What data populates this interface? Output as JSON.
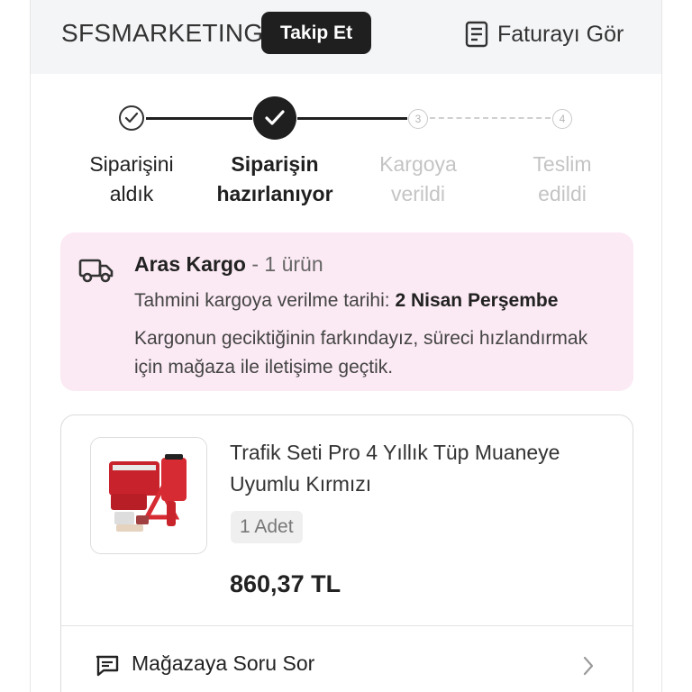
{
  "header": {
    "store_name": "SFSMARKETING",
    "follow_label": "Takip Et",
    "invoice_label": "Faturayı Gör"
  },
  "stepper": {
    "steps": [
      {
        "line1": "Siparişini",
        "line2": "aldık",
        "state": "done"
      },
      {
        "line1": "Siparişin",
        "line2": "hazırlanıyor",
        "state": "current"
      },
      {
        "line1": "Kargoya",
        "line2": "verildi",
        "state": "pending",
        "number": "3"
      },
      {
        "line1": "Teslim",
        "line2": "edildi",
        "state": "pending",
        "number": "4"
      }
    ]
  },
  "cargo": {
    "company": "Aras Kargo",
    "count_text": " - 1 ürün",
    "date_label": "Tahmini kargoya verilme tarihi: ",
    "date_value": "2 Nisan Perşembe",
    "note": "Kargonun geciktiğinin farkındayız, süreci hızlandırmak için mağaza ile iletişime geçtik."
  },
  "product": {
    "name": "Trafik Seti Pro 4 Yıllık Tüp Muaneye Uyumlu Kırmızı",
    "quantity": "1 Adet",
    "price": "860,37 TL"
  },
  "actions": {
    "ask_store_label": "Mağazaya Soru Sor"
  },
  "colors": {
    "accent_dark": "#1f1f1f",
    "cargo_bg": "#fbe9f3",
    "header_bg": "#f4f5f7",
    "pending": "#c4c4c4"
  },
  "icons": {
    "invoice": "document-icon",
    "cargo": "truck-icon",
    "ask": "chat-bubble-icon",
    "row_arrow": "chevron-right-icon"
  }
}
